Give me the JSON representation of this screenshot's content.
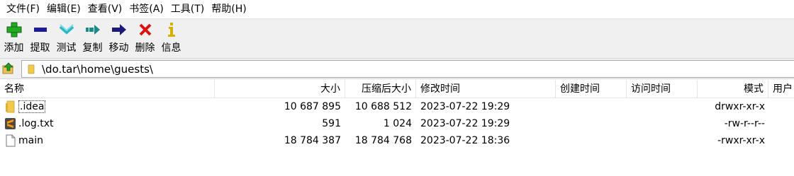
{
  "menubar": {
    "items": [
      "文件(F)",
      "编辑(E)",
      "查看(V)",
      "书签(A)",
      "工具(T)",
      "帮助(H)"
    ]
  },
  "toolbar": {
    "buttons": [
      {
        "label": "添加",
        "icon": "add-icon",
        "color": "#22aa22"
      },
      {
        "label": "提取",
        "icon": "extract-icon",
        "color": "#1a1a9a"
      },
      {
        "label": "测试",
        "icon": "test-icon",
        "color": "#2ab8c8"
      },
      {
        "label": "复制",
        "icon": "copy-icon",
        "color": "#1a8a8a"
      },
      {
        "label": "移动",
        "icon": "move-icon",
        "color": "#1a1a7a"
      },
      {
        "label": "删除",
        "icon": "delete-icon",
        "color": "#dd1111"
      },
      {
        "label": "信息",
        "icon": "info-icon",
        "color": "#d4b000"
      }
    ]
  },
  "address": {
    "path": "\\do.tar\\home\\guests\\"
  },
  "columns": {
    "name": "名称",
    "size": "大小",
    "packed": "压缩后大小",
    "modified": "修改时间",
    "created": "创建时间",
    "accessed": "访问时间",
    "mode": "模式",
    "user": "用户"
  },
  "files": [
    {
      "name": ".idea",
      "type": "folder",
      "size": "10 687 895",
      "packed": "10 688 512",
      "modified": "2023-07-22 19:29",
      "created": "",
      "accessed": "",
      "mode": "drwxr-xr-x"
    },
    {
      "name": ".log.txt",
      "type": "sublime-file",
      "size": "591",
      "packed": "1 024",
      "modified": "2023-07-22 19:29",
      "created": "",
      "accessed": "",
      "mode": "-rw-r--r--"
    },
    {
      "name": "main",
      "type": "file",
      "size": "18 784 387",
      "packed": "18 784 768",
      "modified": "2023-07-22 18:36",
      "created": "",
      "accessed": "",
      "mode": "-rwxr-xr-x"
    }
  ]
}
